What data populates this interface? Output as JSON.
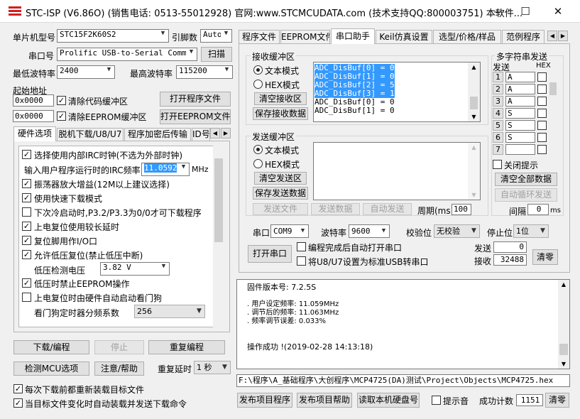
{
  "window": {
    "title": "STC-ISP (V6.86O) (销售电话: 0513-55012928) 官网:www.STCMCUDATA.com  (技术支持QQ:800003751) 本软件...",
    "minimize": "—",
    "maximize": "☐",
    "close": "✕"
  },
  "left": {
    "mcu_label": "单片机型号",
    "mcu_value": "STC15F2K60S2",
    "pins_label": "引脚数",
    "pins_value": "Auto",
    "port_label": "串口号",
    "port_value": "Prolific USB-to-Serial Comm P",
    "scan_button": "扫描",
    "min_baud_label": "最低波特率",
    "min_baud_value": "2400",
    "max_baud_label": "最高波特率",
    "max_baud_value": "115200",
    "start_addr_label": "起始地址",
    "addr1": "0x0000",
    "clear_code_label": "清除代码缓冲区",
    "open_program_button": "打开程序文件",
    "addr2": "0x0000",
    "clear_eeprom_label": "清除EEPROM缓冲区",
    "open_eeprom_button": "打开EEPROM文件",
    "tabs": [
      "硬件选项",
      "脱机下载/U8/U7",
      "程序加密后传输",
      "ID号"
    ],
    "options": {
      "opt1": "选择使用内部IRC时钟(不选为外部时钟)",
      "irc_label": "输入用户程序运行时的IRC频率",
      "irc_value": "11.0592",
      "irc_unit": "MHz",
      "opt2": "振荡器放大增益(12M以上建议选择)",
      "opt3": "使用快速下载模式",
      "opt4": "下次冷启动时,P3.2/P3.3为0/0才可下载程序",
      "opt5": "上电复位使用较长延时",
      "opt6": "复位脚用作I/O口",
      "opt7": "允许低压复位(禁止低压中断)",
      "lv_label": "低压检测电压",
      "lv_value": "3.82 V",
      "opt8": "低压时禁止EEPROM操作",
      "opt9": "上电复位时由硬件自动启动看门狗",
      "wdt_label": "看门狗定时器分频系数",
      "wdt_value": "256"
    },
    "download_button": "下载/编程",
    "stop_button": "停止",
    "reprogram_button": "重复编程",
    "detect_button": "检测MCU选项",
    "help_button": "注意/帮助",
    "retry_label": "重复延时",
    "retry_value": "1 秒",
    "reload_label": "每次下载前都重新装载目标文件",
    "autosend_label": "当目标文件变化时自动装载并发送下载命令"
  },
  "right": {
    "tabs": [
      "程序文件",
      "EEPROM文件",
      "串口助手",
      "Keil仿真设置",
      "选型/价格/样品",
      "范例程序"
    ],
    "recv": {
      "title": "接收缓冲区",
      "text_mode": "文本模式",
      "hex_mode": "HEX模式",
      "clear_button": "清空接收区",
      "save_button": "保存接收数据",
      "lines": [
        "ADC_DisBuf[0] = 0",
        "ADC_DisBuf[1] = 0",
        "ADC_DisBuf[2] = 5",
        "ADC_DisBuf[3] = 1",
        "ADC_DisBuf[0] = 0",
        "ADC_DisBuf[1] = 0"
      ]
    },
    "send": {
      "title": "发送缓冲区",
      "text_mode": "文本模式",
      "hex_mode": "HEX模式",
      "clear_button": "清空发送区",
      "save_button": "保存发送数据",
      "send_file": "发送文件",
      "send_data": "发送数据",
      "auto_send": "自动发送",
      "period_label": "周期(ms)",
      "period_value": "100"
    },
    "multi": {
      "title": "多字符串发送",
      "col_send": "发送",
      "col_hex": "HEX",
      "rows": [
        {
          "n": "1",
          "v": "A"
        },
        {
          "n": "2",
          "v": "A"
        },
        {
          "n": "3",
          "v": "A"
        },
        {
          "n": "4",
          "v": "S"
        },
        {
          "n": "5",
          "v": "S"
        },
        {
          "n": "6",
          "v": "S"
        },
        {
          "n": "7",
          "v": ""
        }
      ],
      "close_hint": "关闭提示",
      "clear_all": "清空全部数据",
      "auto_loop": "自动循环发送",
      "interval_label": "间隔",
      "interval_value": "0",
      "interval_unit": "ms"
    },
    "serial": {
      "port_label": "串口",
      "port_value": "COM9",
      "baud_label": "波特率",
      "baud_value": "9600",
      "parity_label": "校验位",
      "parity_value": "无校验",
      "stop_label": "停止位",
      "stop_value": "1位",
      "open_button": "打开串口",
      "auto_open_label": "编程完成后自动打开串口",
      "usb_label": "将U8/U7设置为标准USB转串口",
      "sent_label": "发送",
      "sent_value": "0",
      "recv_label": "接收",
      "recv_value": "32488",
      "clear_button": "清零"
    },
    "log": [
      "固件版本号: 7.2.5S",
      "",
      ". 用户设定频率: 11.059MHz",
      ". 调节后的频率: 11.063MHz",
      ". 频率调节误差: 0.033%",
      "",
      "",
      "操作成功 !(2019-02-28 14:13:18)"
    ],
    "path": "F:\\程序\\A_基础程序\\大创程序\\MCP4725(DA)测试\\Project\\Objects\\MCP4725.hex",
    "publish_button": "发布项目程序",
    "publish_help_button": "发布项目帮助",
    "read_hdd_button": "读取本机硬盘号",
    "beep_label": "提示音",
    "success_label": "成功计数",
    "success_value": "1151",
    "success_clear": "清零"
  }
}
